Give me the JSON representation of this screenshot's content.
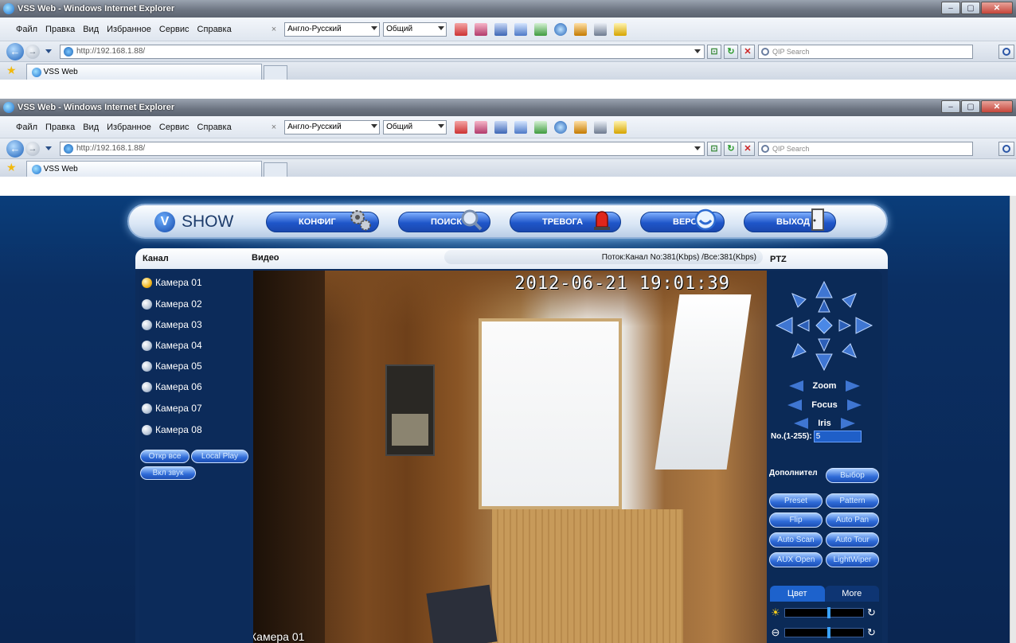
{
  "window": {
    "title": "VSS Web - Windows Internet Explorer",
    "menu": [
      "Файл",
      "Правка",
      "Вид",
      "Избранное",
      "Сервис",
      "Справка"
    ],
    "dict_close": "×",
    "dict_language": "Англо-Русский",
    "dict_category": "Общий",
    "url": "http://192.168.1.88/",
    "search_placeholder": "QIP Search",
    "tab_title": "VSS Web"
  },
  "app": {
    "logo_text": "SHOW",
    "logo_letter": "V",
    "nav": [
      "КОНФИГ",
      "ПОИСК",
      "ТРЕВОГА",
      "ВЕРСИЯ",
      "ВЫХОД"
    ],
    "header": {
      "channel": "Канал",
      "video": "Видео",
      "stream": "Поток:Канал No:381(Kbps) /Все:381(Kbps)",
      "ptz": "PTZ"
    },
    "cameras": [
      "Камера 01",
      "Камера 02",
      "Камера 03",
      "Камера 04",
      "Камера 05",
      "Камера 06",
      "Камера 07",
      "Камера 08"
    ],
    "active_camera_index": 0,
    "buttons": {
      "open_all": "Откр все",
      "local_play": "Local Play",
      "sound_on": "Вкл звук"
    },
    "video": {
      "timestamp": "2012-06-21 19:01:39",
      "camera_label": "Камера 01"
    },
    "ptz": {
      "zoom": "Zoom",
      "focus": "Focus",
      "iris": "Iris",
      "preset_label": "No.(1-255):",
      "preset_value": "5",
      "extra_label": "Дополнител",
      "select": "Выбор",
      "buttons": [
        "Preset",
        "Pattern",
        "Flip",
        "Auto Pan",
        "Auto Scan",
        "Auto Tour",
        "AUX Open",
        "LightWiper"
      ],
      "tab_color": "Цвет",
      "tab_more": "More",
      "brightness_level": 0.55,
      "contrast_level": 0.55
    }
  },
  "colors": {
    "nav_pill": "#1f56c9",
    "panel_bg": "#0d2c5b",
    "accent": "#3f76d2"
  }
}
